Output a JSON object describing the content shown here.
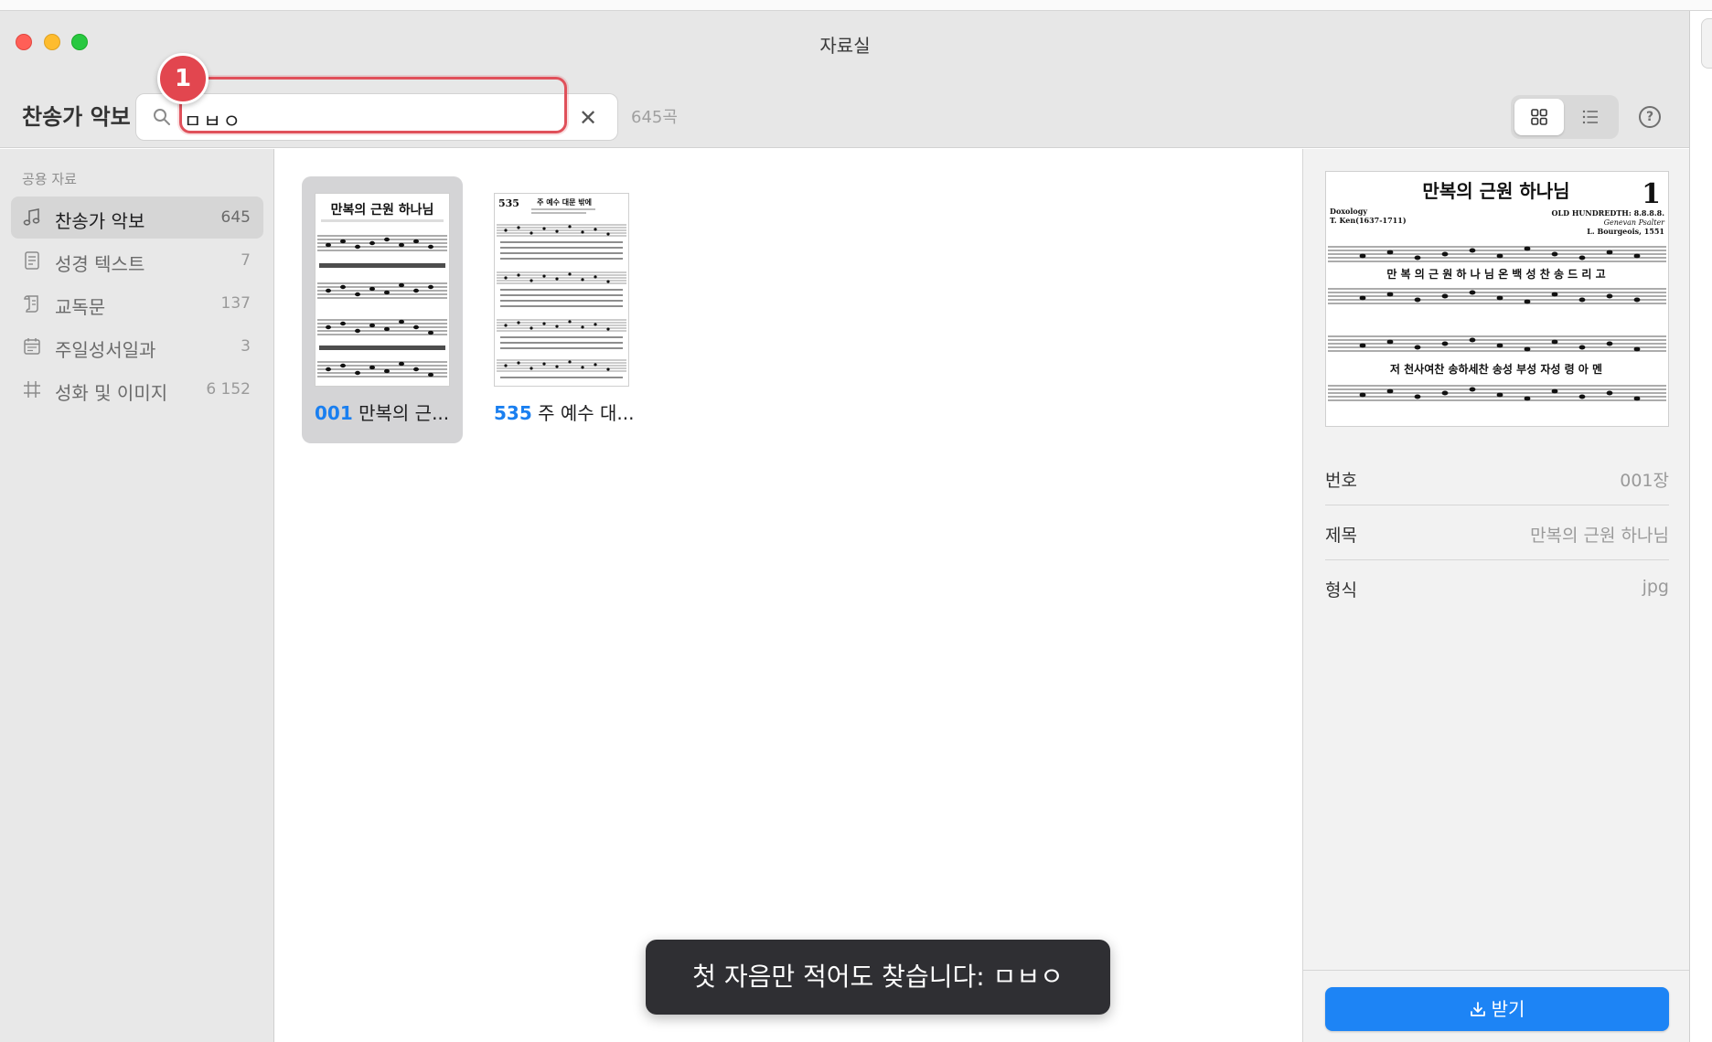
{
  "window": {
    "title": "자료실"
  },
  "toolbar": {
    "section_title": "찬송가 악보",
    "search_value": "ㅁㅂㅇ",
    "clear_symbol": "✕",
    "result_count": "645곡",
    "step_badge": "1",
    "help_symbol": "?"
  },
  "sidebar": {
    "header": "공용 자료",
    "items": [
      {
        "label": "찬송가 악보",
        "count": "645",
        "icon": "music-note-icon",
        "active": true
      },
      {
        "label": "성경 텍스트",
        "count": "7",
        "icon": "document-icon",
        "active": false
      },
      {
        "label": "교독문",
        "count": "137",
        "icon": "scroll-icon",
        "active": false
      },
      {
        "label": "주일성서일과",
        "count": "3",
        "icon": "calendar-icon",
        "active": false
      },
      {
        "label": "성화 및 이미지",
        "count": "6 152",
        "icon": "hash-frame-icon",
        "active": false
      }
    ]
  },
  "results": [
    {
      "number": "001",
      "title": "만복의 근...",
      "thumb_title": "만복의 근원 하나님",
      "selected": true
    },
    {
      "number": "535",
      "title": "주 예수 대...",
      "thumb_title": "주 예수 대문 밖에",
      "selected": false
    }
  ],
  "detail": {
    "preview": {
      "title": "만복의 근원 하나님",
      "number": "1",
      "tune": "OLD HUNDREDTH: 8.8.8.8.",
      "left_line1": "Doxology",
      "left_line2": "T. Ken(1637-1711)",
      "right_line1": "Genevan Psalter",
      "right_line2": "L. Bourgeois, 1551",
      "lyrics1": "만 복 의 근 원 하 나 님 온 백 성 찬 송 드 리 고",
      "lyrics2": "저 천사여찬 송하세찬 송성 부성 자성 령 아 멘"
    },
    "fields": [
      {
        "key": "번호",
        "value": "001장"
      },
      {
        "key": "제목",
        "value": "만복의 근원 하나님"
      },
      {
        "key": "형식",
        "value": "jpg"
      }
    ],
    "download_label": "받기"
  },
  "toast": {
    "message": "첫 자음만 적어도 찾습니다: ㅁㅂㅇ"
  },
  "colors": {
    "accent": "#1d84f5",
    "highlight": "#e0505a",
    "number_blue": "#1a7ff0"
  }
}
